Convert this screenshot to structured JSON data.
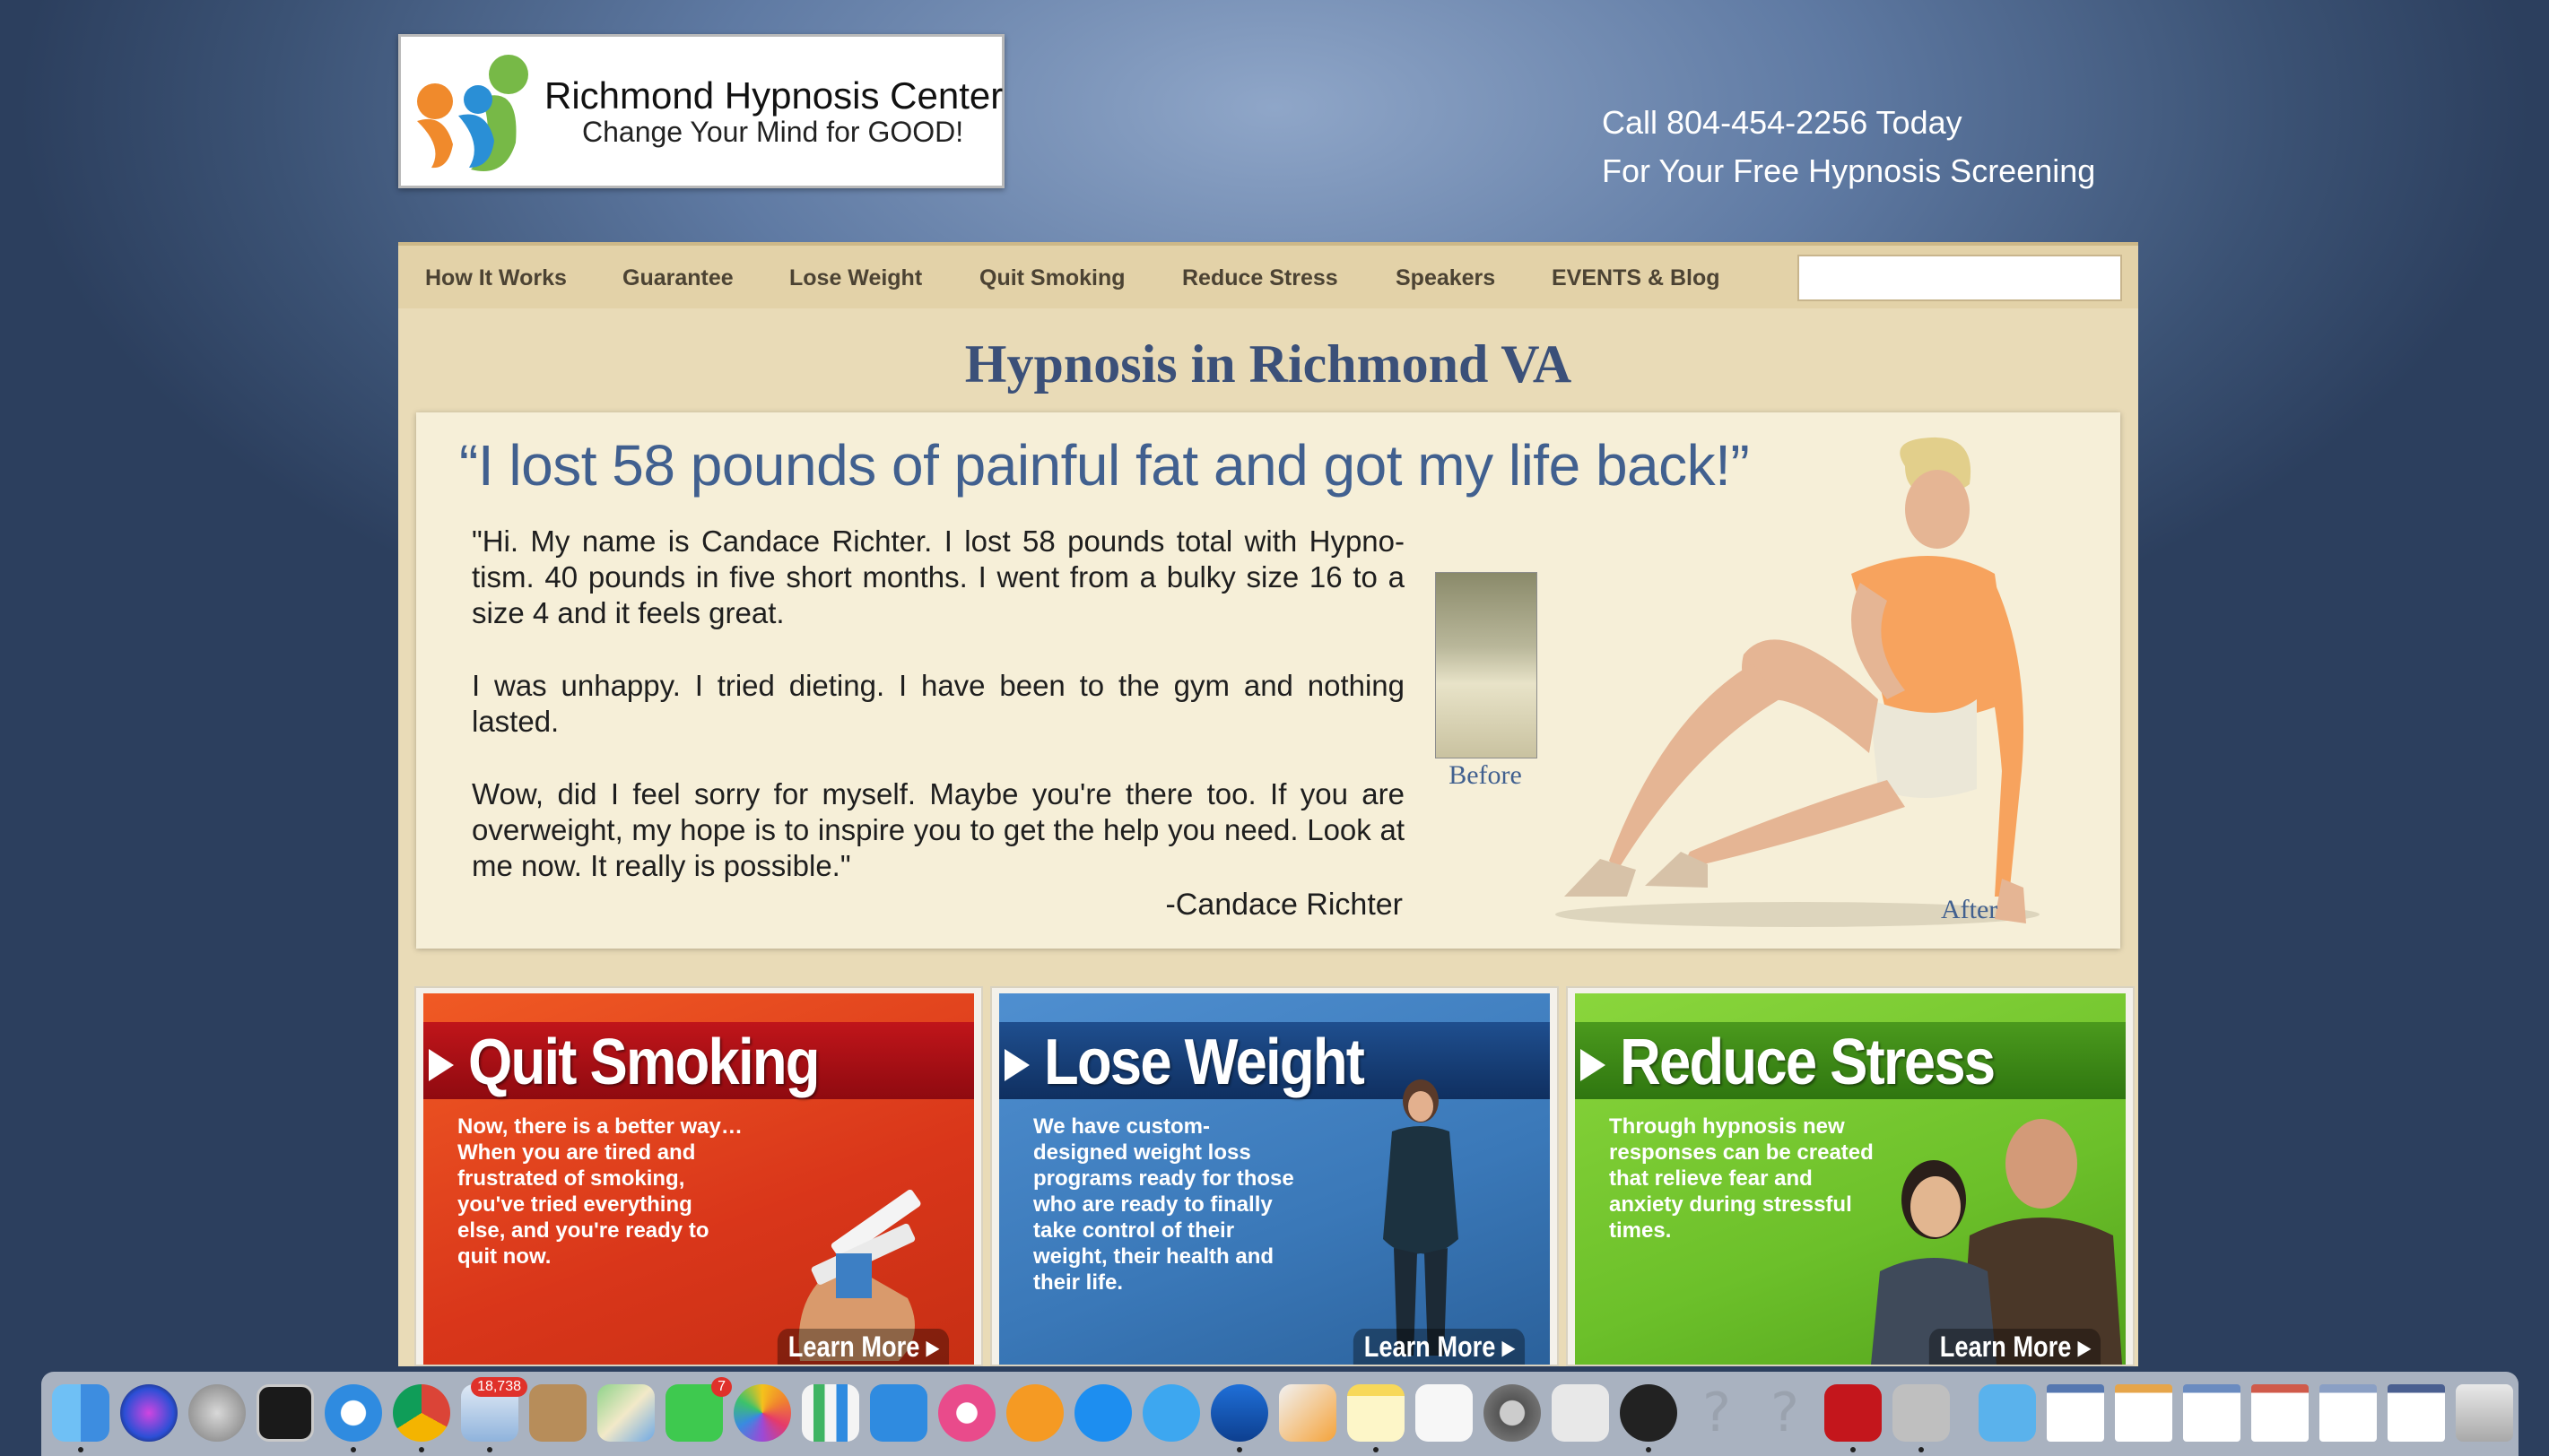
{
  "header": {
    "logo_title": "Richmond Hypnosis Center",
    "logo_tagline": "Change Your Mind for GOOD!",
    "call_line1": "Call 804-454-2256 Today",
    "call_line2": "For Your Free Hypnosis Screening"
  },
  "nav": {
    "items": [
      "How It Works",
      "Guarantee",
      "Lose Weight",
      "Quit Smoking",
      "Reduce Stress",
      "Speakers",
      "EVENTS & Blog"
    ],
    "search_value": ""
  },
  "main": {
    "page_title": "Hypnosis in Richmond VA",
    "headline": "“I lost 58 pounds of painful fat and got my life back!”",
    "paragraphs": [
      "\"Hi. My name is Candace Richter. I lost 58 pounds total with Hypno-tism. 40 pounds in five short months. I went from a bulky size 16 to a size 4 and it feels great.",
      "I was unhappy. I tried dieting. I have been to the gym and nothing lasted.",
      "Wow, did I feel sorry for myself. Maybe you're there too. If you are overweight, my hope is to inspire you to get the help you need. Look at me now.  It really is possible.\""
    ],
    "signature": "-Candace Richter",
    "before_label": "Before",
    "after_label": "After"
  },
  "cards": [
    {
      "title": "Quit Smoking",
      "text": "Now, there is a better way… When you are tired and frustrated of smoking, you've tried everything else, and you're ready to quit now.",
      "cta": "Learn More ▸"
    },
    {
      "title": "Lose Weight",
      "text": "We have custom-designed weight loss programs ready for those who are ready to finally take control of their weight, their health and their life.",
      "cta": "Learn More ▸"
    },
    {
      "title": "Reduce Stress",
      "text": "Through hypnosis new responses can be created that relieve fear and anxiety during stressful times.",
      "cta": "Learn More ▸"
    }
  ],
  "dock": {
    "badges": {
      "mail": "18,738",
      "facetime": "7"
    },
    "icons": [
      "finder-icon",
      "siri-icon",
      "launchpad-icon",
      "activity-monitor-icon",
      "safari-icon",
      "chrome-icon",
      "mail-icon",
      "contacts-icon",
      "maps-icon",
      "facetime-icon",
      "photos-icon",
      "numbers-icon",
      "keynote-icon",
      "itunes-icon",
      "ibooks-icon",
      "app-store-icon",
      "messages-icon",
      "migration-icon",
      "pages-icon",
      "notes-icon",
      "reminders-icon",
      "system-preferences-icon",
      "unity-icon",
      "unity-hub-icon",
      "unknown-app-icon",
      "unknown-app-icon",
      "filezilla-icon",
      "utility-icon",
      "downloads-folder-icon",
      "window-thumbnail-icon",
      "window-thumbnail-icon",
      "window-thumbnail-icon",
      "window-thumbnail-icon",
      "window-thumbnail-icon",
      "window-thumbnail-icon",
      "trash-icon"
    ]
  },
  "colors": {
    "title_blue": "#3b5079",
    "quit_smoking": "#e24a1c",
    "lose_weight": "#3a78b8",
    "reduce_stress": "#6cc02a"
  }
}
